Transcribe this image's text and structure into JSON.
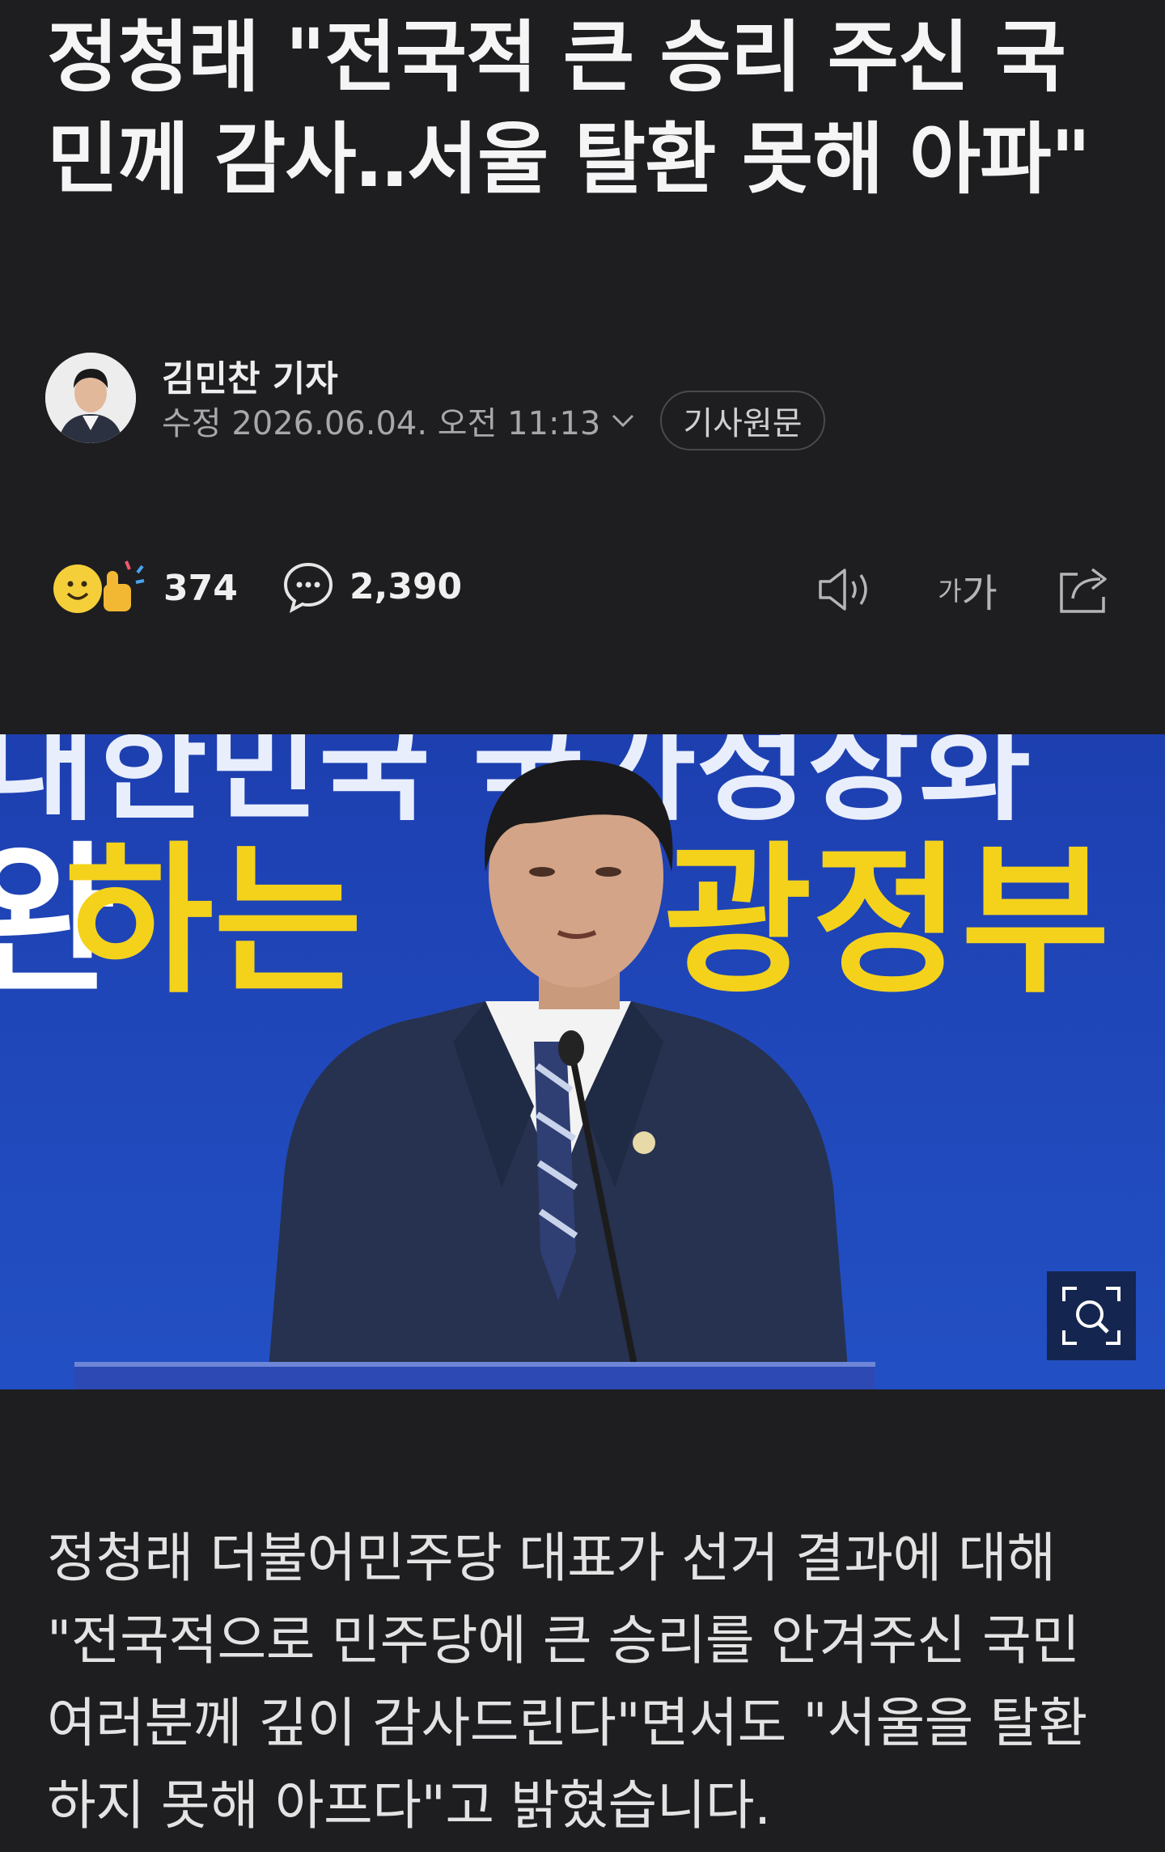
{
  "article": {
    "headline": "정청래 \"전국적 큰 승리 주신 국민께 감사‥서울 탈환 못해 아파\"",
    "reporter": "김민찬 기자",
    "edit_time": "수정 2026.06.04. 오전 11:13",
    "original_button": "기사원문",
    "reaction_count": "374",
    "comment_count": "2,390",
    "font_tool_small": "가",
    "font_tool_large": "가",
    "body": "정청래 더불어민주당 대표가 선거 결과에 대해 \"전국적으로 민주당에 큰 승리를 안겨주신 국민 여러분께 깊이 감사드린다\"면서도 \"서울을 탈환하지 못해 아프다\"고 밝혔습니다."
  },
  "photo": {
    "banner_top": "대한민국 국가정상화",
    "banner_white": "완수하는 ",
    "banner_mid": "하는 ",
    "banner_yellow": "광정부",
    "banner_yellow2": "부"
  },
  "icons": {
    "reaction": "reaction-emoji-icon",
    "comment": "comment-bubble-icon",
    "speak": "speaker-icon",
    "share": "share-icon",
    "zoom": "zoom-search-icon",
    "chevron": "chevron-down-icon"
  },
  "colors": {
    "background": "#1e1e20",
    "banner_blue": "#2346b8",
    "banner_yellow": "#f4d21c"
  }
}
